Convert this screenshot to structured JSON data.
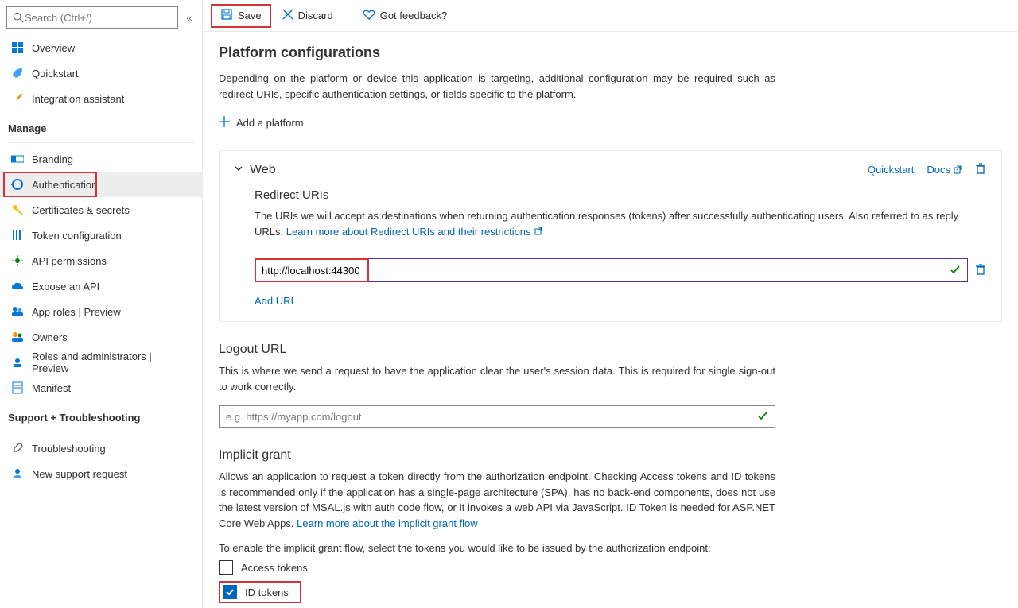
{
  "search": {
    "placeholder": "Search (Ctrl+/)"
  },
  "nav": {
    "overview": "Overview",
    "quickstart": "Quickstart",
    "integration": "Integration assistant",
    "manage_header": "Manage",
    "branding": "Branding",
    "authentication": "Authentication",
    "certificates": "Certificates & secrets",
    "token_config": "Token configuration",
    "api_permissions": "API permissions",
    "expose_api": "Expose an API",
    "app_roles": "App roles | Preview",
    "owners": "Owners",
    "roles_admins": "Roles and administrators | Preview",
    "manifest": "Manifest",
    "support_header": "Support + Troubleshooting",
    "troubleshooting": "Troubleshooting",
    "new_support": "New support request"
  },
  "toolbar": {
    "save": "Save",
    "discard": "Discard",
    "feedback": "Got feedback?"
  },
  "platform": {
    "title": "Platform configurations",
    "desc": "Depending on the platform or device this application is targeting, additional configuration may be required such as redirect URIs, specific authentication settings, or fields specific to the platform.",
    "add": "Add a platform"
  },
  "web": {
    "title": "Web",
    "quickstart_link": "Quickstart",
    "docs_link": "Docs",
    "redirect_title": "Redirect URIs",
    "redirect_desc": "The URIs we will accept as destinations when returning authentication responses (tokens) after successfully authenticating users. Also referred to as reply URLs. ",
    "learn_more": "Learn more about Redirect URIs and their restrictions",
    "uri_value": "http://localhost:44300",
    "add_uri": "Add URI"
  },
  "logout": {
    "title": "Logout URL",
    "desc": "This is where we send a request to have the application clear the user's session data. This is required for single sign-out to work correctly.",
    "placeholder": "e.g. https://myapp.com/logout"
  },
  "implicit": {
    "title": "Implicit grant",
    "desc1": "Allows an application to request a token directly from the authorization endpoint. Checking Access tokens and ID tokens is recommended only if the application has a single-page architecture (SPA), has no back-end components, does not use the latest version of MSAL.js with auth code flow, or it invokes a web API via JavaScript. ID Token is needed for ASP.NET Core Web Apps. ",
    "learn_more": "Learn more about the implicit grant flow",
    "desc2": "To enable the implicit grant flow, select the tokens you would like to be issued by the authorization endpoint:",
    "access_tokens": "Access tokens",
    "id_tokens": "ID tokens"
  }
}
